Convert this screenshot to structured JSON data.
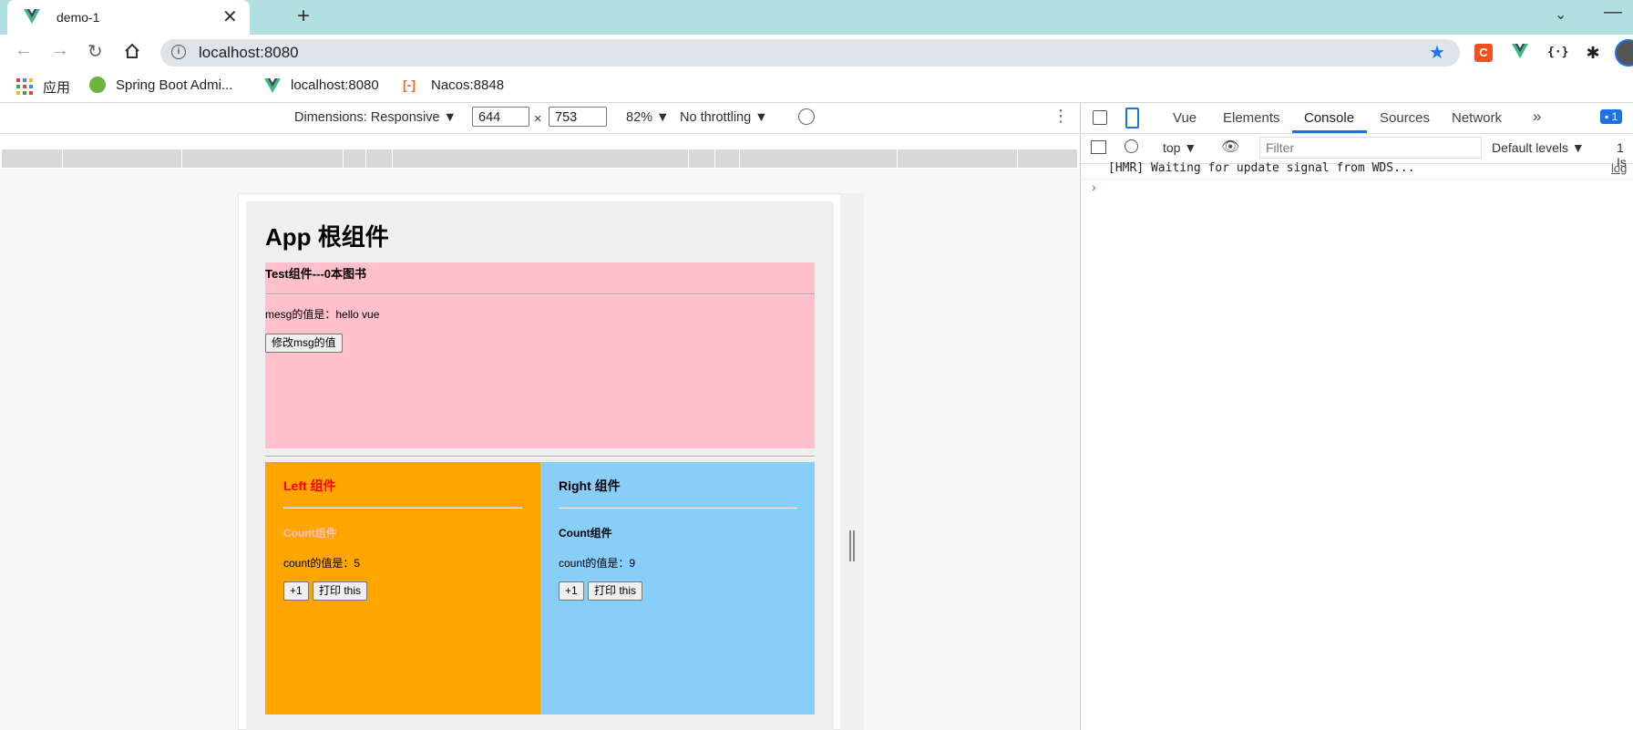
{
  "browser": {
    "tab_title": "demo-1",
    "url": "localhost:8080",
    "bookmarks": [
      {
        "label": "应用"
      },
      {
        "label": "Spring Boot Admi..."
      },
      {
        "label": "localhost:8080"
      },
      {
        "label": "Nacos:8848"
      }
    ]
  },
  "device_toolbar": {
    "dimensions_label": "Dimensions: Responsive ▼",
    "width": "644",
    "times": "×",
    "height": "753",
    "zoom": "82% ▼",
    "throttle": "No throttling ▼"
  },
  "app": {
    "title": "App 根组件",
    "test": {
      "heading": "Test组件---0本图书",
      "msg": "mesg的值是：hello vue",
      "button": "修改msg的值"
    },
    "left": {
      "heading": "Left 组件",
      "count_heading": "Count组件",
      "count_text": "count的值是：5",
      "plus_button": "+1",
      "print_button": "打印 this"
    },
    "right": {
      "heading": "Right 组件",
      "count_heading": "Count组件",
      "count_text": "count的值是：9",
      "plus_button": "+1",
      "print_button": "打印 this"
    }
  },
  "devtools": {
    "tabs": [
      "Vue",
      "Elements",
      "Console",
      "Sources",
      "Network"
    ],
    "active_tab": "Console",
    "issues": "1",
    "context": "top ▼",
    "filter_placeholder": "Filter",
    "levels": "Default levels ▼",
    "issues_right": "1 Is",
    "log_message": "[HMR] Waiting for update signal from WDS...",
    "log_source": "log"
  },
  "colors": {
    "tabstrip": "#b2dfe0",
    "test_bg": "#ffc0cb",
    "left_bg": "#ffa500",
    "right_bg": "#87cefa",
    "accent": "#1a73e8"
  }
}
